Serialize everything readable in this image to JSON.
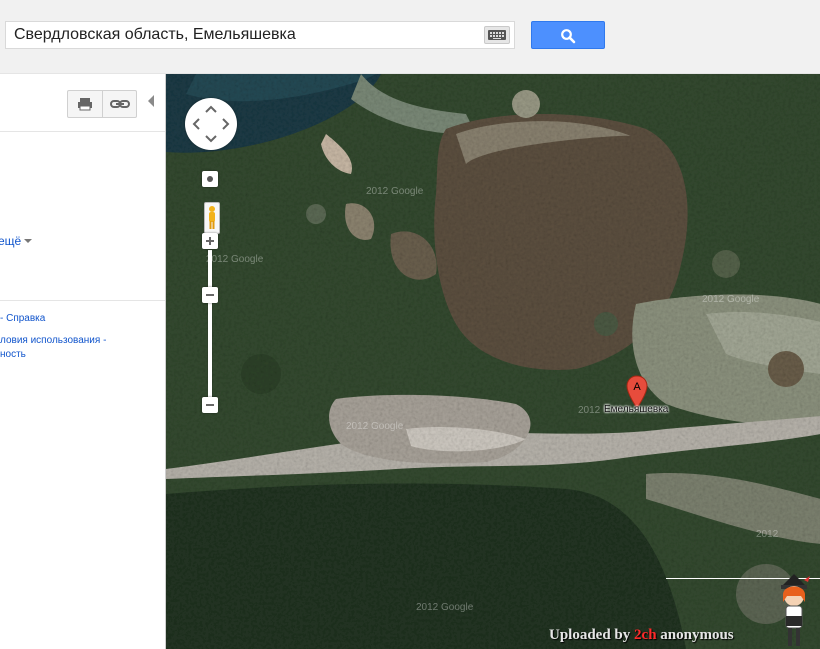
{
  "search": {
    "value": "Свердловская область, Емельяшевка",
    "keyboard_icon": "keyboard-icon",
    "button_icon": "magnifier-icon"
  },
  "left_panel": {
    "toolbar": {
      "print_icon": "print-icon",
      "link_icon": "link-icon"
    },
    "more_link": "ещё",
    "footer": {
      "help": "- Справка",
      "terms": "ловия использования -",
      "privacy": "ность"
    }
  },
  "map": {
    "marker_letter": "A",
    "marker_label": "Емельяшевка",
    "watermarks": [
      "2012 Google",
      "2012 Google",
      "2012 Google",
      "2012 Google",
      "2012",
      "2012",
      "2012 Google"
    ],
    "uploaded_prefix": "Uploaded by ",
    "uploaded_brand": "2ch",
    "uploaded_suffix": " anonymous",
    "colors": {
      "marker": "#e74c3c",
      "search_button": "#4d90fe",
      "link": "#1155cc"
    }
  }
}
